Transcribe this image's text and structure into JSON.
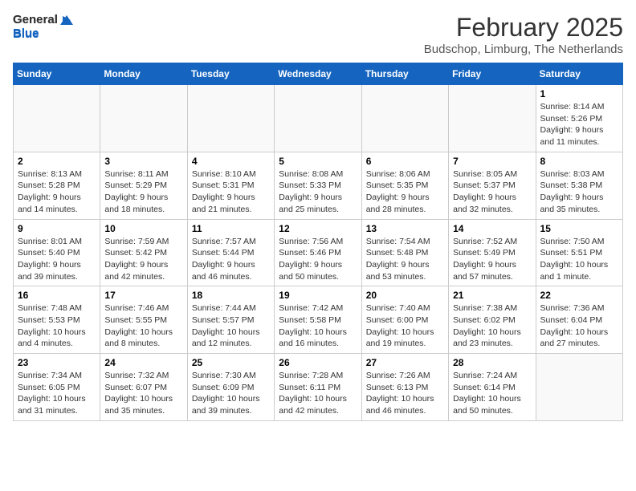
{
  "header": {
    "logo_general": "General",
    "logo_blue": "Blue",
    "month_title": "February 2025",
    "location": "Budschop, Limburg, The Netherlands"
  },
  "weekdays": [
    "Sunday",
    "Monday",
    "Tuesday",
    "Wednesday",
    "Thursday",
    "Friday",
    "Saturday"
  ],
  "weeks": [
    [
      {
        "day": "",
        "info": ""
      },
      {
        "day": "",
        "info": ""
      },
      {
        "day": "",
        "info": ""
      },
      {
        "day": "",
        "info": ""
      },
      {
        "day": "",
        "info": ""
      },
      {
        "day": "",
        "info": ""
      },
      {
        "day": "1",
        "info": "Sunrise: 8:14 AM\nSunset: 5:26 PM\nDaylight: 9 hours and 11 minutes."
      }
    ],
    [
      {
        "day": "2",
        "info": "Sunrise: 8:13 AM\nSunset: 5:28 PM\nDaylight: 9 hours and 14 minutes."
      },
      {
        "day": "3",
        "info": "Sunrise: 8:11 AM\nSunset: 5:29 PM\nDaylight: 9 hours and 18 minutes."
      },
      {
        "day": "4",
        "info": "Sunrise: 8:10 AM\nSunset: 5:31 PM\nDaylight: 9 hours and 21 minutes."
      },
      {
        "day": "5",
        "info": "Sunrise: 8:08 AM\nSunset: 5:33 PM\nDaylight: 9 hours and 25 minutes."
      },
      {
        "day": "6",
        "info": "Sunrise: 8:06 AM\nSunset: 5:35 PM\nDaylight: 9 hours and 28 minutes."
      },
      {
        "day": "7",
        "info": "Sunrise: 8:05 AM\nSunset: 5:37 PM\nDaylight: 9 hours and 32 minutes."
      },
      {
        "day": "8",
        "info": "Sunrise: 8:03 AM\nSunset: 5:38 PM\nDaylight: 9 hours and 35 minutes."
      }
    ],
    [
      {
        "day": "9",
        "info": "Sunrise: 8:01 AM\nSunset: 5:40 PM\nDaylight: 9 hours and 39 minutes."
      },
      {
        "day": "10",
        "info": "Sunrise: 7:59 AM\nSunset: 5:42 PM\nDaylight: 9 hours and 42 minutes."
      },
      {
        "day": "11",
        "info": "Sunrise: 7:57 AM\nSunset: 5:44 PM\nDaylight: 9 hours and 46 minutes."
      },
      {
        "day": "12",
        "info": "Sunrise: 7:56 AM\nSunset: 5:46 PM\nDaylight: 9 hours and 50 minutes."
      },
      {
        "day": "13",
        "info": "Sunrise: 7:54 AM\nSunset: 5:48 PM\nDaylight: 9 hours and 53 minutes."
      },
      {
        "day": "14",
        "info": "Sunrise: 7:52 AM\nSunset: 5:49 PM\nDaylight: 9 hours and 57 minutes."
      },
      {
        "day": "15",
        "info": "Sunrise: 7:50 AM\nSunset: 5:51 PM\nDaylight: 10 hours and 1 minute."
      }
    ],
    [
      {
        "day": "16",
        "info": "Sunrise: 7:48 AM\nSunset: 5:53 PM\nDaylight: 10 hours and 4 minutes."
      },
      {
        "day": "17",
        "info": "Sunrise: 7:46 AM\nSunset: 5:55 PM\nDaylight: 10 hours and 8 minutes."
      },
      {
        "day": "18",
        "info": "Sunrise: 7:44 AM\nSunset: 5:57 PM\nDaylight: 10 hours and 12 minutes."
      },
      {
        "day": "19",
        "info": "Sunrise: 7:42 AM\nSunset: 5:58 PM\nDaylight: 10 hours and 16 minutes."
      },
      {
        "day": "20",
        "info": "Sunrise: 7:40 AM\nSunset: 6:00 PM\nDaylight: 10 hours and 19 minutes."
      },
      {
        "day": "21",
        "info": "Sunrise: 7:38 AM\nSunset: 6:02 PM\nDaylight: 10 hours and 23 minutes."
      },
      {
        "day": "22",
        "info": "Sunrise: 7:36 AM\nSunset: 6:04 PM\nDaylight: 10 hours and 27 minutes."
      }
    ],
    [
      {
        "day": "23",
        "info": "Sunrise: 7:34 AM\nSunset: 6:05 PM\nDaylight: 10 hours and 31 minutes."
      },
      {
        "day": "24",
        "info": "Sunrise: 7:32 AM\nSunset: 6:07 PM\nDaylight: 10 hours and 35 minutes."
      },
      {
        "day": "25",
        "info": "Sunrise: 7:30 AM\nSunset: 6:09 PM\nDaylight: 10 hours and 39 minutes."
      },
      {
        "day": "26",
        "info": "Sunrise: 7:28 AM\nSunset: 6:11 PM\nDaylight: 10 hours and 42 minutes."
      },
      {
        "day": "27",
        "info": "Sunrise: 7:26 AM\nSunset: 6:13 PM\nDaylight: 10 hours and 46 minutes."
      },
      {
        "day": "28",
        "info": "Sunrise: 7:24 AM\nSunset: 6:14 PM\nDaylight: 10 hours and 50 minutes."
      },
      {
        "day": "",
        "info": ""
      }
    ]
  ]
}
